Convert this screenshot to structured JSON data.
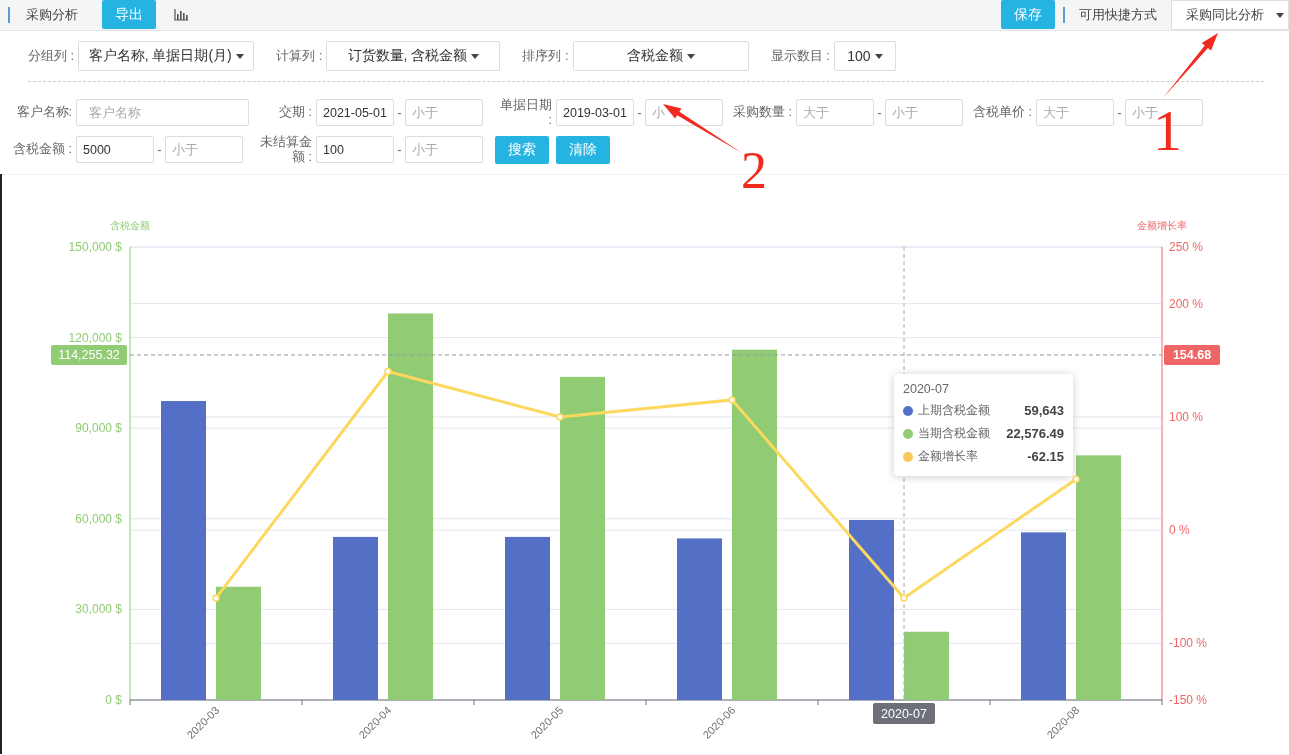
{
  "toolbar": {
    "title": "采购分析",
    "export_button": "导出",
    "save_button": "保存",
    "shortcuts_label": "可用快捷方式",
    "shortcut_select": "采购同比分析"
  },
  "options": [
    {
      "label": "分组列 :",
      "value": "客户名称, 单据日期(月)"
    },
    {
      "label": "计算列 :",
      "value": "订货数量, 含税金额"
    },
    {
      "label": "排序列 :",
      "value": "含税金额"
    },
    {
      "label": "显示数目 :",
      "value": "100"
    }
  ],
  "filter_rows": [
    {
      "groups": [
        {
          "label": "客户名称:",
          "kind": "single",
          "fields": [
            {
              "placeholder": "客户名称"
            }
          ]
        },
        {
          "label": "交期 :",
          "kind": "range",
          "separator": "-",
          "fields": [
            {
              "value": "2021-05-01"
            },
            {
              "placeholder": "小于"
            }
          ]
        },
        {
          "label": "单据日期 :",
          "kind": "range",
          "separator": "-",
          "fields": [
            {
              "value": "2019-03-01"
            },
            {
              "placeholder": "小"
            }
          ]
        },
        {
          "label": "采购数量 :",
          "kind": "range",
          "separator": "-",
          "fields": [
            {
              "placeholder": "大于"
            },
            {
              "placeholder": "小于"
            }
          ]
        },
        {
          "label": "含税单价 :",
          "kind": "range",
          "separator": "-",
          "fields": [
            {
              "placeholder": "大于"
            },
            {
              "placeholder": "小于"
            }
          ]
        }
      ]
    },
    {
      "groups": [
        {
          "label": "含税金额 :",
          "kind": "range",
          "separator": "-",
          "fields": [
            {
              "value": "5000"
            },
            {
              "placeholder": "小于"
            }
          ]
        },
        {
          "label": "未结算金额 :",
          "kind": "range",
          "separator": "-",
          "fields": [
            {
              "value": "100"
            },
            {
              "placeholder": "小于"
            }
          ]
        }
      ]
    }
  ],
  "actions": [
    "搜索",
    "清除"
  ],
  "chart": {
    "chart_data": {
      "type": "bar",
      "grid": true,
      "categories": [
        "2020-03",
        "2020-04",
        "2020-05",
        "2020-06",
        "2020-07",
        "2020-08"
      ],
      "series": [
        {
          "color": "#5470c6",
          "values": [
            99000,
            54000,
            54000,
            53500,
            59600,
            55500
          ]
        },
        {
          "color": "#91cc75",
          "values": [
            37500,
            128000,
            107000,
            116000,
            22600,
            81000
          ]
        },
        {
          "color": "#fdd85e",
          "type": "line",
          "axis": "y2",
          "marker": "circle",
          "values": [
            -60,
            140,
            100,
            115,
            -60,
            45
          ]
        }
      ],
      "ylabel": "含税金额",
      "y2label": "金额增长率",
      "ylim": [
        0,
        150000
      ],
      "yticks": [
        {
          "value": 0,
          "label": "0 $"
        },
        {
          "value": 30000,
          "label": "30,000 $"
        },
        {
          "value": 60000,
          "label": "60,000 $"
        },
        {
          "value": 90000,
          "label": "90,000 $"
        },
        {
          "value": 120000,
          "label": "120,000 $"
        },
        {
          "value": 150000,
          "label": "150,000 $"
        }
      ],
      "y2lim": [
        -150,
        250
      ],
      "y2ticks": [
        {
          "value": -150,
          "label": "-150 %"
        },
        {
          "value": -100,
          "label": "-100 %"
        },
        {
          "value": 0,
          "label": "0 %"
        },
        {
          "value": 100,
          "label": "100 %"
        },
        {
          "value": 200,
          "label": "200 %"
        },
        {
          "value": 250,
          "label": "250 %"
        }
      ],
      "ref_lines": [
        {
          "axis": "y",
          "value": 114255.32,
          "label": "114,255.32"
        },
        {
          "axis": "x",
          "value": "2020-07"
        }
      ]
    },
    "pointer_right_badge": "154.68",
    "tooltip": {
      "title": "2020-07",
      "rows": [
        {
          "label": "上期含税金额",
          "value": "59,643",
          "color": "#5470c6"
        },
        {
          "label": "当期含税金额",
          "value": "22,576.49",
          "color": "#91cc75"
        },
        {
          "label": "金额增长率",
          "value": "-62.15",
          "color": "#fac858"
        }
      ]
    }
  },
  "annotations": [
    {
      "number": "1"
    },
    {
      "number": "2"
    }
  ]
}
